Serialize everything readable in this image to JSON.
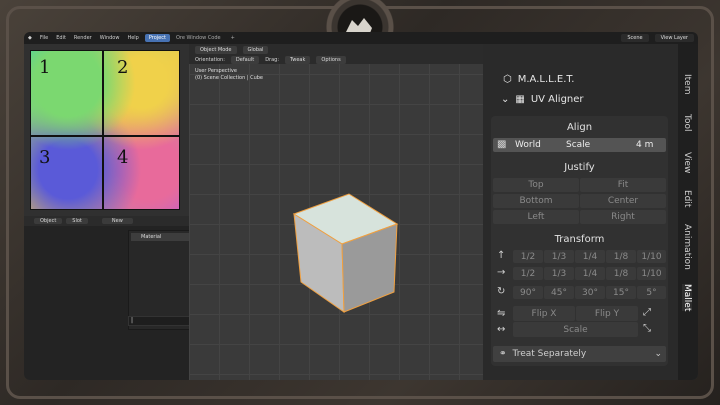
{
  "topbar": {
    "menus": [
      "File",
      "Edit",
      "Render",
      "Window",
      "Help"
    ],
    "tabs": [
      {
        "label": "Project",
        "active": true
      },
      {
        "label": "Ore Window Code",
        "active": false
      }
    ],
    "add_tab": "+",
    "global_label": "Global",
    "scene_label": "Scene",
    "view_layer_label": "View Layer",
    "options_label": "Options"
  },
  "uv_image": {
    "quadrants": [
      "1",
      "2",
      "3",
      "4"
    ]
  },
  "material_panel": {
    "object_label": "Object",
    "slot_label": "Slot",
    "new_label": "New",
    "items": [
      "Material"
    ],
    "search_value": "|"
  },
  "viewport": {
    "mode_label": "Object Mode",
    "orientation_label": "Orientation:",
    "orientation_value": "Default",
    "drag_label": "Drag:",
    "drag_value": "Tweak",
    "info_line1": "User Perspective",
    "info_line2": "(0) Scene Collection | Cube",
    "accent": "#f0a040"
  },
  "npanel": {
    "addon_title": "M.A.L.L.E.T.",
    "panel_title": "UV Aligner",
    "align": {
      "label": "Align",
      "space": "World",
      "scale_label": "Scale",
      "scale_value": "4 m"
    },
    "justify": {
      "label": "Justify",
      "buttons": [
        "Top",
        "Fit",
        "Bottom",
        "Center",
        "Left",
        "Right"
      ]
    },
    "transform": {
      "label": "Transform",
      "row_up": [
        "1/2",
        "1/3",
        "1/4",
        "1/8",
        "1/10"
      ],
      "row_right": [
        "1/2",
        "1/3",
        "1/4",
        "1/8",
        "1/10"
      ],
      "row_rotate": [
        "90°",
        "45°",
        "30°",
        "15°",
        "5°"
      ],
      "flip_x": "Flip X",
      "flip_y": "Flip Y",
      "scale": "Scale"
    },
    "treat_label": "Treat Separately",
    "side_tabs": [
      "Item",
      "Tool",
      "View",
      "Edit",
      "Animation",
      "Mallet"
    ]
  }
}
